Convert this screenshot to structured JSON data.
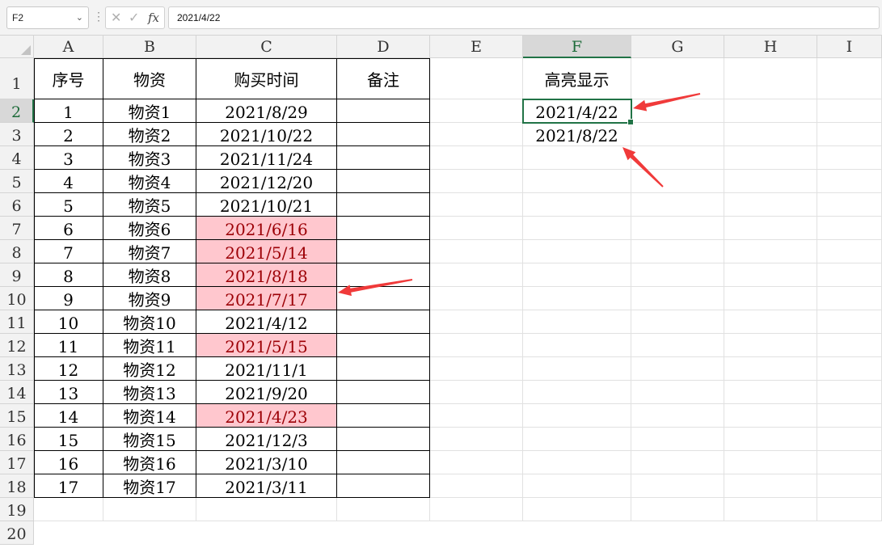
{
  "formula_bar": {
    "name_box": "F2",
    "fx_label": "fx",
    "formula": "2021/4/22"
  },
  "columns": [
    "A",
    "B",
    "C",
    "D",
    "E",
    "F",
    "G",
    "H",
    "I"
  ],
  "active_column": "F",
  "active_row": 2,
  "sheet": {
    "header_row": [
      "序号",
      "物资",
      "购买时间",
      "备注"
    ],
    "rows": [
      {
        "no": "1",
        "item": "物资1",
        "date": "2021/8/29",
        "note": "",
        "highlight": false
      },
      {
        "no": "2",
        "item": "物资2",
        "date": "2021/10/22",
        "note": "",
        "highlight": false
      },
      {
        "no": "3",
        "item": "物资3",
        "date": "2021/11/24",
        "note": "",
        "highlight": false
      },
      {
        "no": "4",
        "item": "物资4",
        "date": "2021/12/20",
        "note": "",
        "highlight": false
      },
      {
        "no": "5",
        "item": "物资5",
        "date": "2021/10/21",
        "note": "",
        "highlight": false
      },
      {
        "no": "6",
        "item": "物资6",
        "date": "2021/6/16",
        "note": "",
        "highlight": true
      },
      {
        "no": "7",
        "item": "物资7",
        "date": "2021/5/14",
        "note": "",
        "highlight": true
      },
      {
        "no": "8",
        "item": "物资8",
        "date": "2021/8/18",
        "note": "",
        "highlight": true
      },
      {
        "no": "9",
        "item": "物资9",
        "date": "2021/7/17",
        "note": "",
        "highlight": true
      },
      {
        "no": "10",
        "item": "物资10",
        "date": "2021/4/12",
        "note": "",
        "highlight": false
      },
      {
        "no": "11",
        "item": "物资11",
        "date": "2021/5/15",
        "note": "",
        "highlight": true
      },
      {
        "no": "12",
        "item": "物资12",
        "date": "2021/11/1",
        "note": "",
        "highlight": false
      },
      {
        "no": "13",
        "item": "物资13",
        "date": "2021/9/20",
        "note": "",
        "highlight": false
      },
      {
        "no": "14",
        "item": "物资14",
        "date": "2021/4/23",
        "note": "",
        "highlight": true
      },
      {
        "no": "15",
        "item": "物资15",
        "date": "2021/12/3",
        "note": "",
        "highlight": false
      },
      {
        "no": "16",
        "item": "物资16",
        "date": "2021/3/10",
        "note": "",
        "highlight": false
      },
      {
        "no": "17",
        "item": "物资17",
        "date": "2021/3/11",
        "note": "",
        "highlight": false
      }
    ],
    "side_title": "高亮显示",
    "side_values": [
      "2021/4/22",
      "2021/8/22"
    ]
  },
  "colors": {
    "highlight_fill": "#ffc7ce",
    "highlight_text": "#9c0006",
    "selection": "#217346",
    "annotation_arrow": "#f03a3a"
  },
  "icons": [
    "chevron-down-icon",
    "cancel-icon",
    "confirm-icon",
    "function-icon"
  ]
}
